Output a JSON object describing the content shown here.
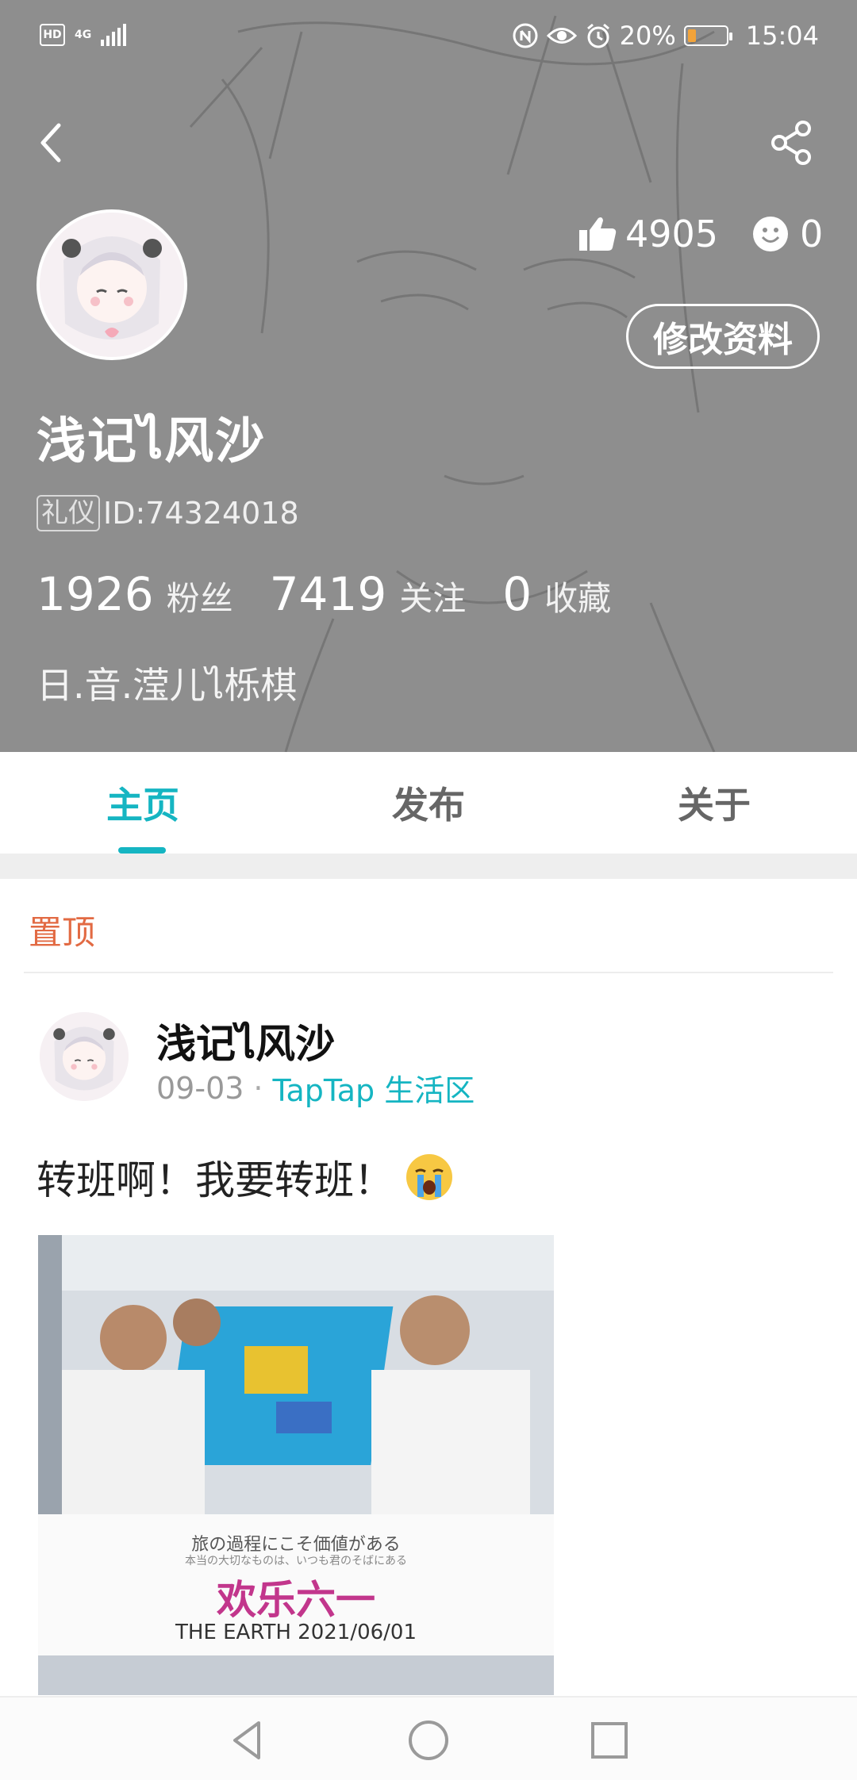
{
  "status_bar": {
    "hd": "HD",
    "network": "4G",
    "battery_text": "20%",
    "time": "15:04",
    "icons": [
      "nfc-icon",
      "eye-icon",
      "alarm-icon"
    ]
  },
  "profile": {
    "likes": "4905",
    "emoji_count": "0",
    "edit_button": "修改资料",
    "username": "浅记ไ风沙",
    "badge": "礼仪",
    "id": "ID:74324018",
    "stats": [
      {
        "num": "1926",
        "label": "粉丝"
      },
      {
        "num": "7419",
        "label": "关注"
      },
      {
        "num": "0",
        "label": "收藏"
      }
    ],
    "bio": "日.音.滢儿ไ栎棋"
  },
  "tabs": [
    {
      "label": "主页",
      "active": true
    },
    {
      "label": "发布",
      "active": false
    },
    {
      "label": "关于",
      "active": false
    }
  ],
  "feed": {
    "pinned_label": "置顶",
    "post": {
      "author": "浅记ไ风沙",
      "date": "09-03",
      "separator": "·",
      "forum": "TapTap 生活区",
      "text": "转班啊！我要转班！",
      "image": {
        "caption_line1": "旅の過程にこそ価値がある",
        "caption_line2": "本当の大切なものは、いつも君のそばにある",
        "title": "欢乐六一",
        "footer": "THE EARTH  2021/06/01"
      }
    }
  },
  "colors": {
    "accent": "#15b5c2",
    "pinned": "#e26a43",
    "header_bg": "#8f8f8f",
    "image_title": "#c2368c"
  }
}
